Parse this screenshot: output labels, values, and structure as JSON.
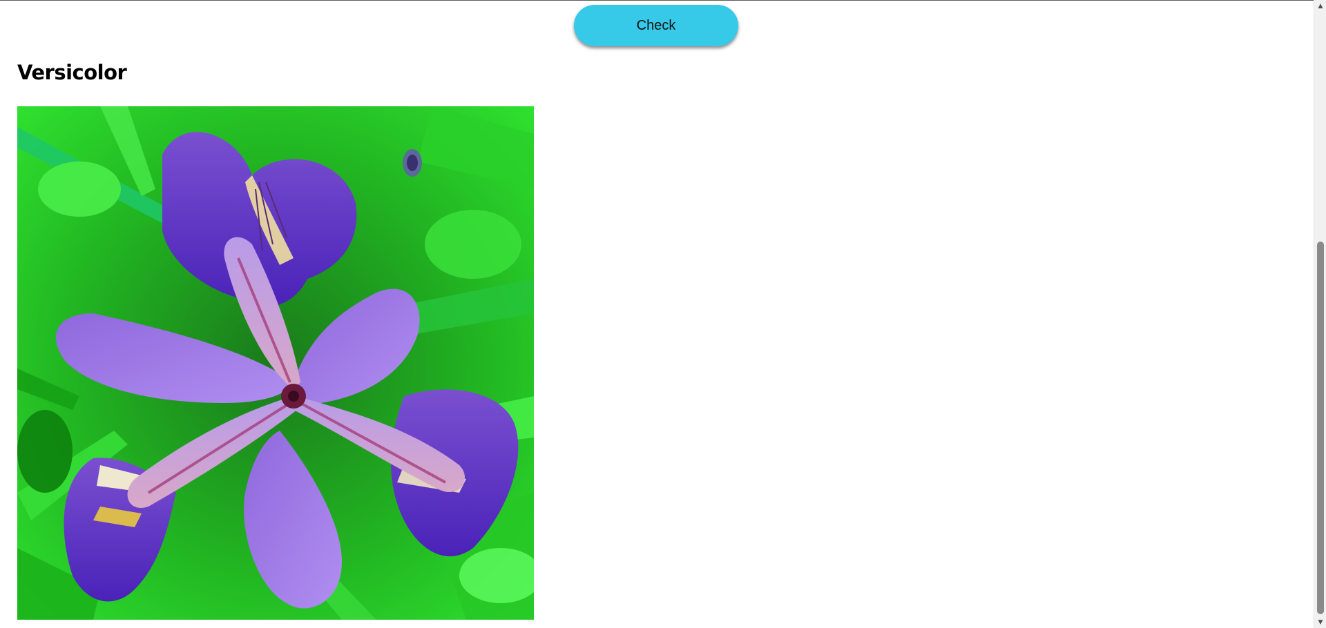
{
  "check_button": {
    "label": "Check"
  },
  "page": {
    "title": "Versicolor"
  },
  "image": {
    "subject": "purple iris versicolor flower on green foliage"
  },
  "scrollbar": {
    "up_arrow": "▲",
    "down_arrow": "▼"
  },
  "colors": {
    "button": "#36c9e8",
    "petal": "#9a6ee0",
    "leaf": "#2ed12e"
  }
}
